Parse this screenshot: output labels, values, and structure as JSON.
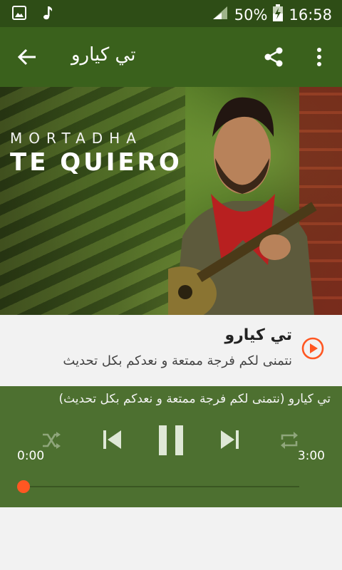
{
  "status_bar": {
    "battery": "50%",
    "time": "16:58",
    "icons": [
      "image-icon",
      "music-note-icon",
      "signal-icon",
      "battery-charging-icon"
    ]
  },
  "app_bar": {
    "title": "تي كيارو",
    "icons": [
      "back-arrow-icon",
      "share-icon",
      "more-vert-icon"
    ]
  },
  "hero": {
    "artist": "MORTADHA",
    "song": "TE QUIERO"
  },
  "track": {
    "name": "تي كيارو",
    "description": "نتمنى لكم فرجة ممتعة و نعدكم بكل تحديث"
  },
  "player": {
    "now_playing": "تي كيارو (نتمنى لكم فرجة ممتعة و نعدكم بكل تحديث)",
    "current_time": "0:00",
    "total_time": "3:00",
    "progress": 0,
    "accent_color": "#ff5722",
    "panel_color": "#4d7030"
  },
  "colors": {
    "status_bar": "#2e4d16",
    "app_bar": "#3a611c",
    "play_icon": "#ff5722"
  }
}
